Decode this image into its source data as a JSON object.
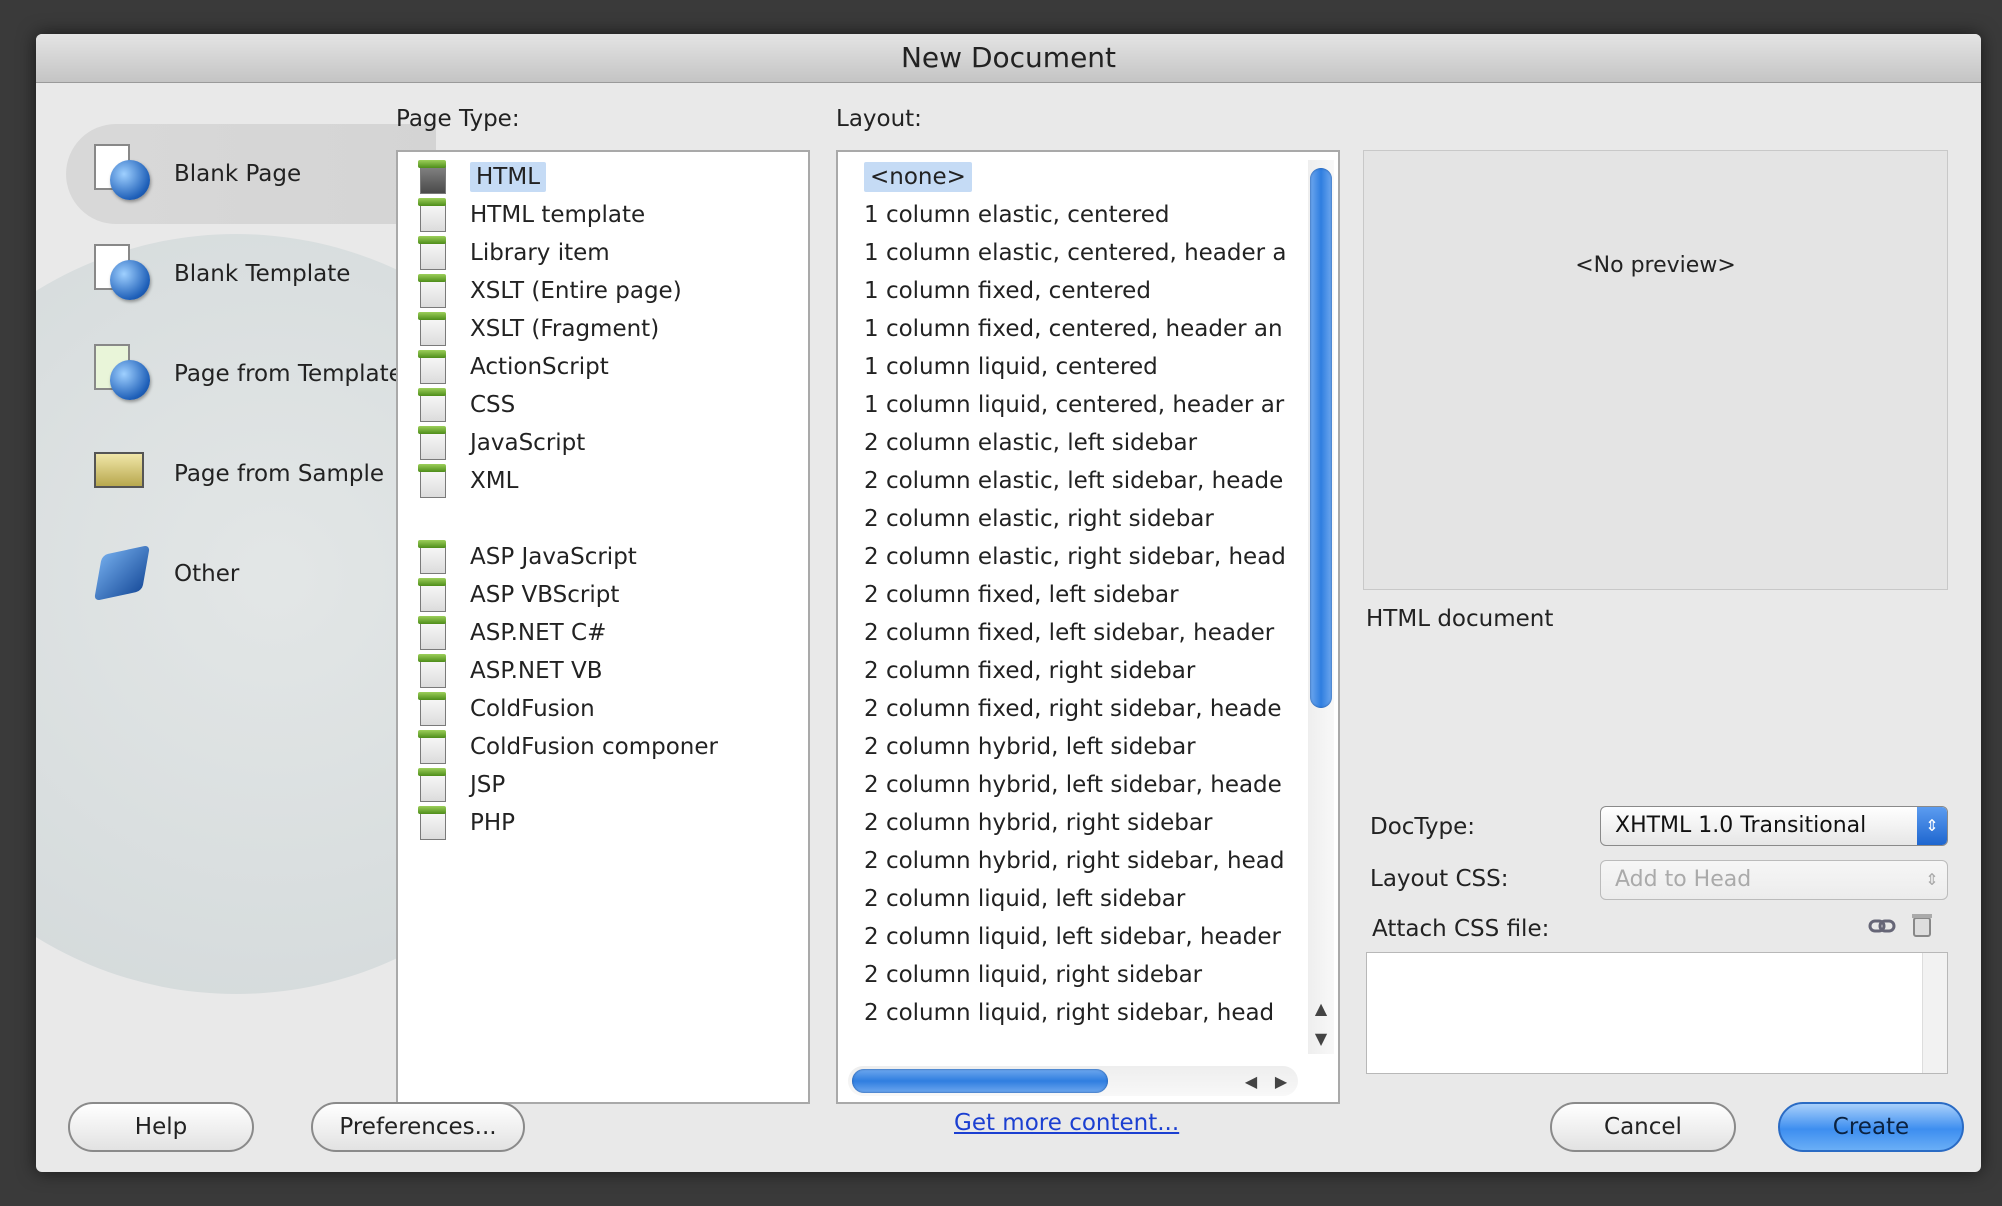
{
  "window": {
    "title": "New Document"
  },
  "categories": [
    {
      "label": "Blank Page",
      "icon": "blank-page-icon",
      "selected": true
    },
    {
      "label": "Blank Template",
      "icon": "blank-template-icon",
      "selected": false
    },
    {
      "label": "Page from Template",
      "icon": "page-from-template-icon",
      "selected": false
    },
    {
      "label": "Page from Sample",
      "icon": "page-from-sample-icon",
      "selected": false
    },
    {
      "label": "Other",
      "icon": "other-icon",
      "selected": false
    }
  ],
  "page_type": {
    "header": "Page Type:",
    "items": [
      "HTML",
      "HTML template",
      "Library item",
      "XSLT (Entire page)",
      "XSLT (Fragment)",
      "ActionScript",
      "CSS",
      "JavaScript",
      "XML",
      "ASP JavaScript",
      "ASP VBScript",
      "ASP.NET C#",
      "ASP.NET VB",
      "ColdFusion",
      "ColdFusion componer",
      "JSP",
      "PHP"
    ],
    "selected": "HTML"
  },
  "layout": {
    "header": "Layout:",
    "items": [
      "<none>",
      "1 column elastic, centered",
      "1 column elastic, centered, header a",
      "1 column fixed, centered",
      "1 column fixed, centered, header an",
      "1 column liquid, centered",
      "1 column liquid, centered, header ar",
      "2 column elastic, left sidebar",
      "2 column elastic, left sidebar, heade",
      "2 column elastic, right sidebar",
      "2 column elastic, right sidebar, head",
      "2 column fixed, left sidebar",
      "2 column fixed, left sidebar, header",
      "2 column fixed, right sidebar",
      "2 column fixed, right sidebar, heade",
      "2 column hybrid, left sidebar",
      "2 column hybrid, left sidebar, heade",
      "2 column hybrid, right sidebar",
      "2 column hybrid, right sidebar, head",
      "2 column liquid, left sidebar",
      "2 column liquid, left sidebar, header",
      "2 column liquid, right sidebar",
      "2 column liquid, right sidebar, head"
    ],
    "selected": "<none>"
  },
  "preview": {
    "text": "<No preview>",
    "description": "HTML document"
  },
  "doctype": {
    "label": "DocType:",
    "value": "XHTML 1.0 Transitional"
  },
  "layout_css": {
    "label": "Layout CSS:",
    "value": "Add to Head"
  },
  "attach_css": {
    "label": "Attach CSS file:"
  },
  "buttons": {
    "help": "Help",
    "preferences": "Preferences...",
    "get_more": "Get more content...",
    "cancel": "Cancel",
    "create": "Create"
  },
  "colors": {
    "accent": "#3d8ef0",
    "selection": "#c5dbf5",
    "link": "#1b3fd1"
  }
}
